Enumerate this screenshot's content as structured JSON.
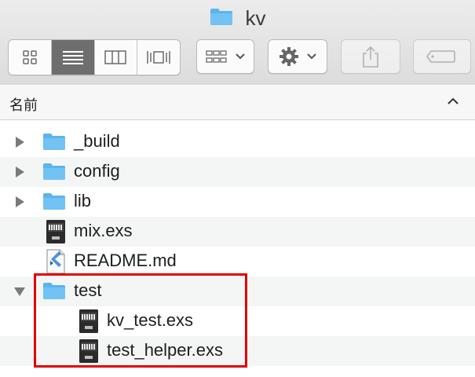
{
  "window": {
    "title": "kv",
    "folder_color": "#5ab4ee"
  },
  "toolbar": {
    "view_modes": [
      "icon-view",
      "list-view",
      "column-view",
      "cover-flow-view"
    ],
    "active_view": "list-view",
    "group_button_icon": "grid-icon",
    "action_button_icon": "gear-icon",
    "share_button_icon": "share-icon",
    "tag_button_icon": "tag-icon"
  },
  "list_header": {
    "name_column": "名前",
    "sort_direction_icon": "chevron-up-icon"
  },
  "files": [
    {
      "name": "_build",
      "kind": "folder",
      "disclosure": "collapsed"
    },
    {
      "name": "config",
      "kind": "folder",
      "disclosure": "collapsed"
    },
    {
      "name": "lib",
      "kind": "folder",
      "disclosure": "collapsed"
    },
    {
      "name": "mix.exs",
      "kind": "exec"
    },
    {
      "name": "README.md",
      "kind": "markdown"
    },
    {
      "name": "test",
      "kind": "folder",
      "disclosure": "expanded"
    },
    {
      "name": "kv_test.exs",
      "kind": "exec",
      "indent": 1
    },
    {
      "name": "test_helper.exs",
      "kind": "exec",
      "indent": 1
    }
  ],
  "highlight_color": "#e10000"
}
